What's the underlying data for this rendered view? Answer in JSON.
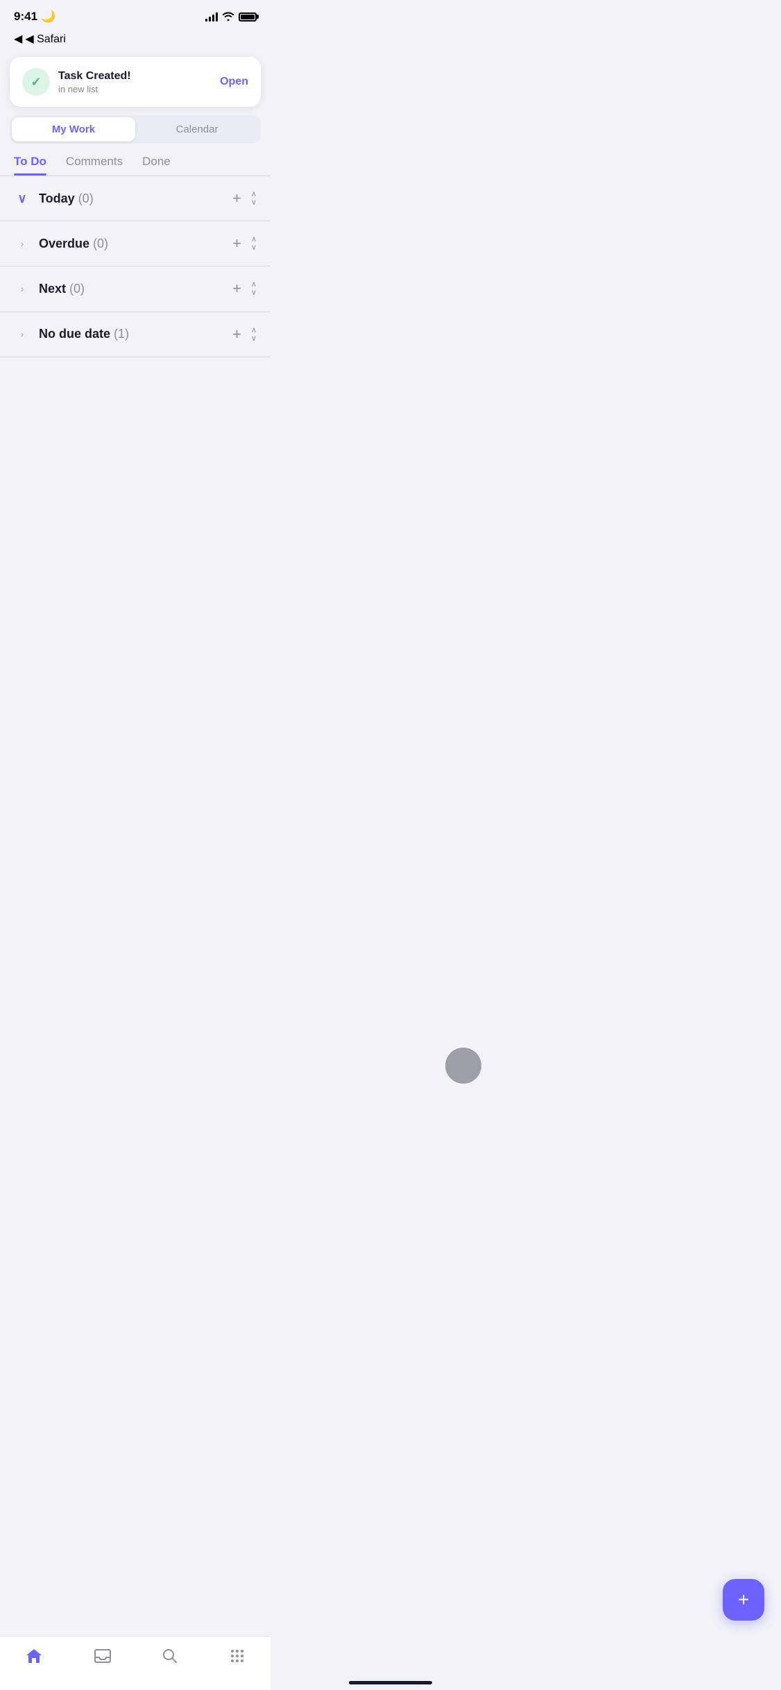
{
  "status_bar": {
    "time": "9:41",
    "moon": "🌙"
  },
  "safari_back": "◀ Safari",
  "notification": {
    "title": "Task Created!",
    "subtitle": "in new list",
    "action": "Open",
    "check": "✓"
  },
  "main_tabs": [
    {
      "id": "my-work",
      "label": "My Work",
      "active": true
    },
    {
      "id": "calendar",
      "label": "Calendar",
      "active": false
    }
  ],
  "sub_tabs": [
    {
      "id": "todo",
      "label": "To Do",
      "active": true
    },
    {
      "id": "comments",
      "label": "Comments",
      "active": false
    },
    {
      "id": "done",
      "label": "Done",
      "active": false
    }
  ],
  "sections": [
    {
      "id": "today",
      "label": "Today",
      "count": "(0)",
      "expanded": true
    },
    {
      "id": "overdue",
      "label": "Overdue",
      "count": "(0)",
      "expanded": false
    },
    {
      "id": "next",
      "label": "Next",
      "count": "(0)",
      "expanded": false
    },
    {
      "id": "no-due-date",
      "label": "No due date",
      "count": "(1)",
      "expanded": false
    }
  ],
  "fab": {
    "label": "+"
  },
  "bottom_nav": [
    {
      "id": "home",
      "label": "home",
      "icon": "house",
      "active": true
    },
    {
      "id": "inbox",
      "label": "inbox",
      "icon": "tray",
      "active": false
    },
    {
      "id": "search",
      "label": "search",
      "icon": "magnifier",
      "active": false
    },
    {
      "id": "more",
      "label": "more",
      "icon": "grid",
      "active": false
    }
  ],
  "colors": {
    "accent": "#6c63ff",
    "green": "#4caf7d",
    "green_bg": "#dcf5e7",
    "text_primary": "#1a1a2e",
    "text_secondary": "#8e8e9a",
    "divider": "#d8d8e0",
    "bg": "#f2f2f7"
  }
}
